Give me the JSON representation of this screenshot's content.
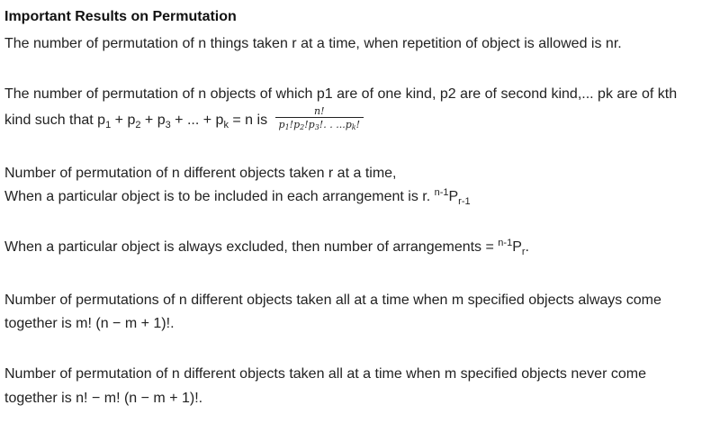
{
  "heading": "Important Results on Permutation",
  "p1": {
    "text": "The number of permutation of n things taken r at a time, when repetition of object is allowed is nr."
  },
  "p2": {
    "line1": "The number of permutation of n objects of which p1 are of one kind, p2 are of second kind,... pk are of kth",
    "line2_prefix": "kind such that p",
    "s1": "1",
    "plus1": " + p",
    "s2": "2",
    "plus2": " + p",
    "s3": "3",
    "plus3": " + ... + p",
    "sk": "k",
    "line2_suffix": " = n is",
    "frac_num": "n!",
    "frac_p": "p",
    "frac_s1": "1",
    "frac_bang1": "!p",
    "frac_s2": "2",
    "frac_bang2": "!p",
    "frac_s3": "3",
    "frac_bang3": "!. . ...p",
    "frac_sk": "k",
    "frac_end": "!"
  },
  "p3": {
    "line1": "Number of permutation of n different objects taken r at a time,",
    "line2": "When a particular object is to be included in each arrangement is r. ",
    "sup": "n-1",
    "p": "P",
    "sub": "r-1"
  },
  "p4": {
    "text": "When a particular object is always excluded, then number of arrangements = ",
    "sup": "n-1",
    "p": "P",
    "sub": "r",
    "end": "."
  },
  "p5": {
    "line1": "Number of permutations of n different objects taken all at a time when m specified objects always come",
    "line2": "together is m! (n − m + 1)!."
  },
  "p6": {
    "line1": "Number of permutation of n different objects taken all at a time when m specified objects never come",
    "line2": "together is n! − m! (n − m + 1)!."
  }
}
